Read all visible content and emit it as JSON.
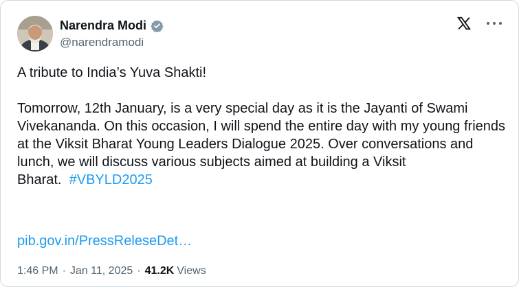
{
  "author": {
    "display_name": "Narendra Modi",
    "handle": "@narendramodi",
    "verified": true
  },
  "icons": {
    "verified": "verified-badge-icon",
    "logo": "x-logo-icon",
    "more": "more-options-icon"
  },
  "colors": {
    "link": "#1d9bf0",
    "text": "#0f1419",
    "muted": "#536471",
    "border": "#cfd9de"
  },
  "post": {
    "line1": "A tribute to India’s Yuva Shakti!",
    "para2_text": "Tomorrow, 12th January, is a very special day as it is the Jayanti of Swami Vivekananda. On this occasion, I will spend the entire day with my young friends at the Viksit Bharat Young Leaders Dialogue 2025. Over conversations and lunch, we will discuss various subjects aimed at building a Viksit Bharat.",
    "hashtag": "#VBYLD2025",
    "link": "pib.gov.in/PressReleseDet…"
  },
  "meta": {
    "time": "1:46 PM",
    "date": "Jan 11, 2025",
    "views_count": "41.2K",
    "views_label": "Views"
  }
}
